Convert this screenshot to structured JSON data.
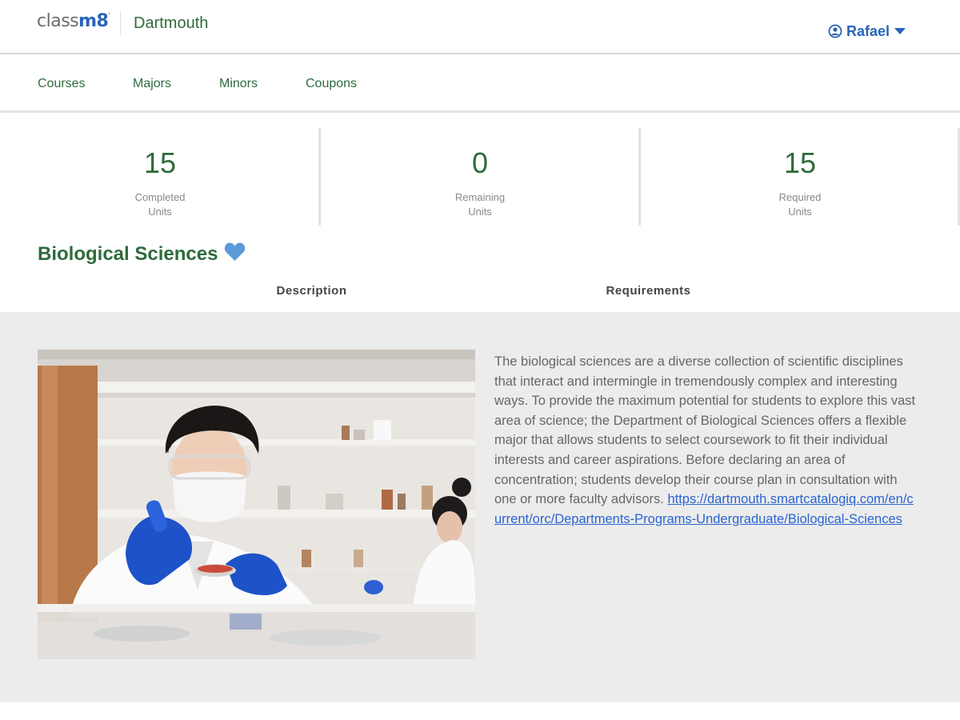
{
  "header": {
    "logo_prefix": "class",
    "logo_m8": "m8",
    "school": "Dartmouth",
    "user_name": "Rafael"
  },
  "nav": {
    "items": [
      {
        "label": "Courses"
      },
      {
        "label": "Majors"
      },
      {
        "label": "Minors"
      },
      {
        "label": "Coupons"
      }
    ]
  },
  "stats": [
    {
      "value": "15",
      "label_line1": "Completed",
      "label_line2": "Units"
    },
    {
      "value": "0",
      "label_line1": "Remaining",
      "label_line2": "Units"
    },
    {
      "value": "15",
      "label_line1": "Required",
      "label_line2": "Units"
    }
  ],
  "major": {
    "title": "Biological Sciences",
    "favorite_icon": "heart-icon"
  },
  "tabs": [
    {
      "label": "Description",
      "active": true
    },
    {
      "label": "Requirements",
      "active": false
    }
  ],
  "description": {
    "text": "The biological sciences are a diverse collection of scientific disciplines that interact and intermingle in tremendously complex and interesting ways. To provide the maximum potential for students to explore this vast area of science; the Department of Biological Sciences offers a flexible major that allows students to select coursework to fit their individual interests and career aspirations. Before declaring an area of concentration; students develop their course plan in consultation with one or more faculty advisors.",
    "link": "https://dartmouth.smartcatalogiq.com/en/current/orc/Departments-Programs-Undergraduate/Biological-Sciences"
  },
  "colors": {
    "brand_green": "#2e6b3c",
    "brand_blue": "#2a64b8",
    "link_blue": "#2a64d4",
    "content_bg": "#ececec"
  }
}
